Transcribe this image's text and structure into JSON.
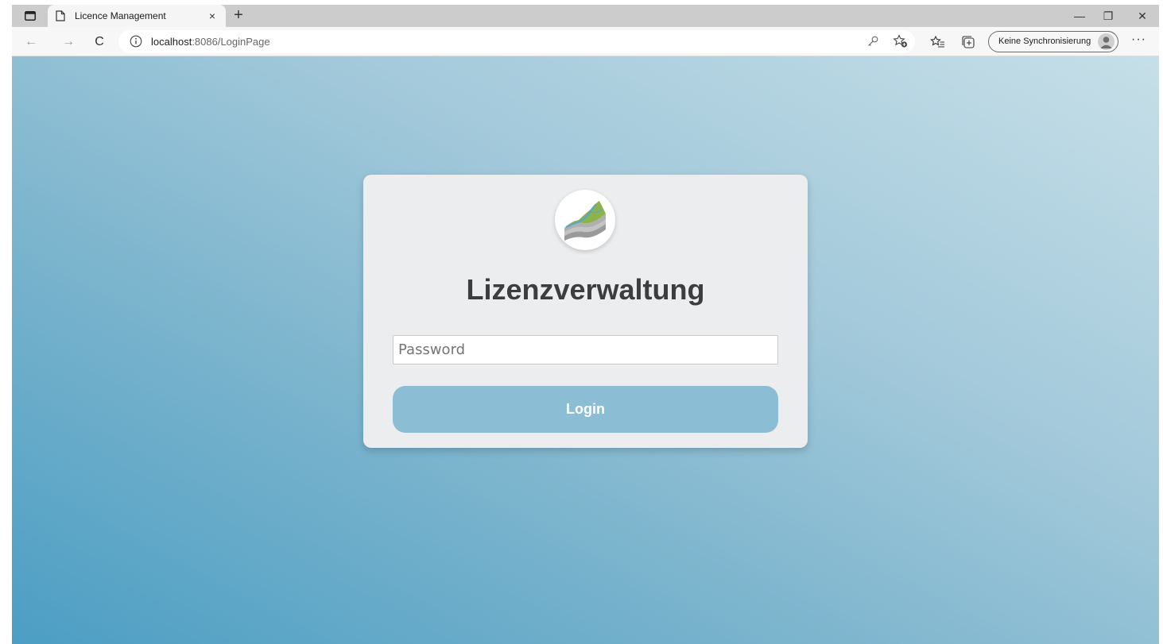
{
  "browser": {
    "tab": {
      "title": "Licence Management",
      "close_label": "×"
    },
    "new_tab_label": "+",
    "window_controls": {
      "minimize": "—",
      "restore": "❐",
      "close": "✕"
    },
    "nav": {
      "back": "←",
      "forward": "→",
      "reload": "C"
    },
    "address": {
      "host": "localhost",
      "rest": ":8086/LoginPage"
    },
    "sync_label": "Keine Synchronisierung",
    "more_label": "···"
  },
  "page": {
    "heading": "Lizenzverwaltung",
    "password_placeholder": "Password",
    "password_value": "",
    "login_label": "Login"
  },
  "colors": {
    "card": "#ecedef",
    "button": "#8bbdd4",
    "heading": "#3d3d3d"
  }
}
